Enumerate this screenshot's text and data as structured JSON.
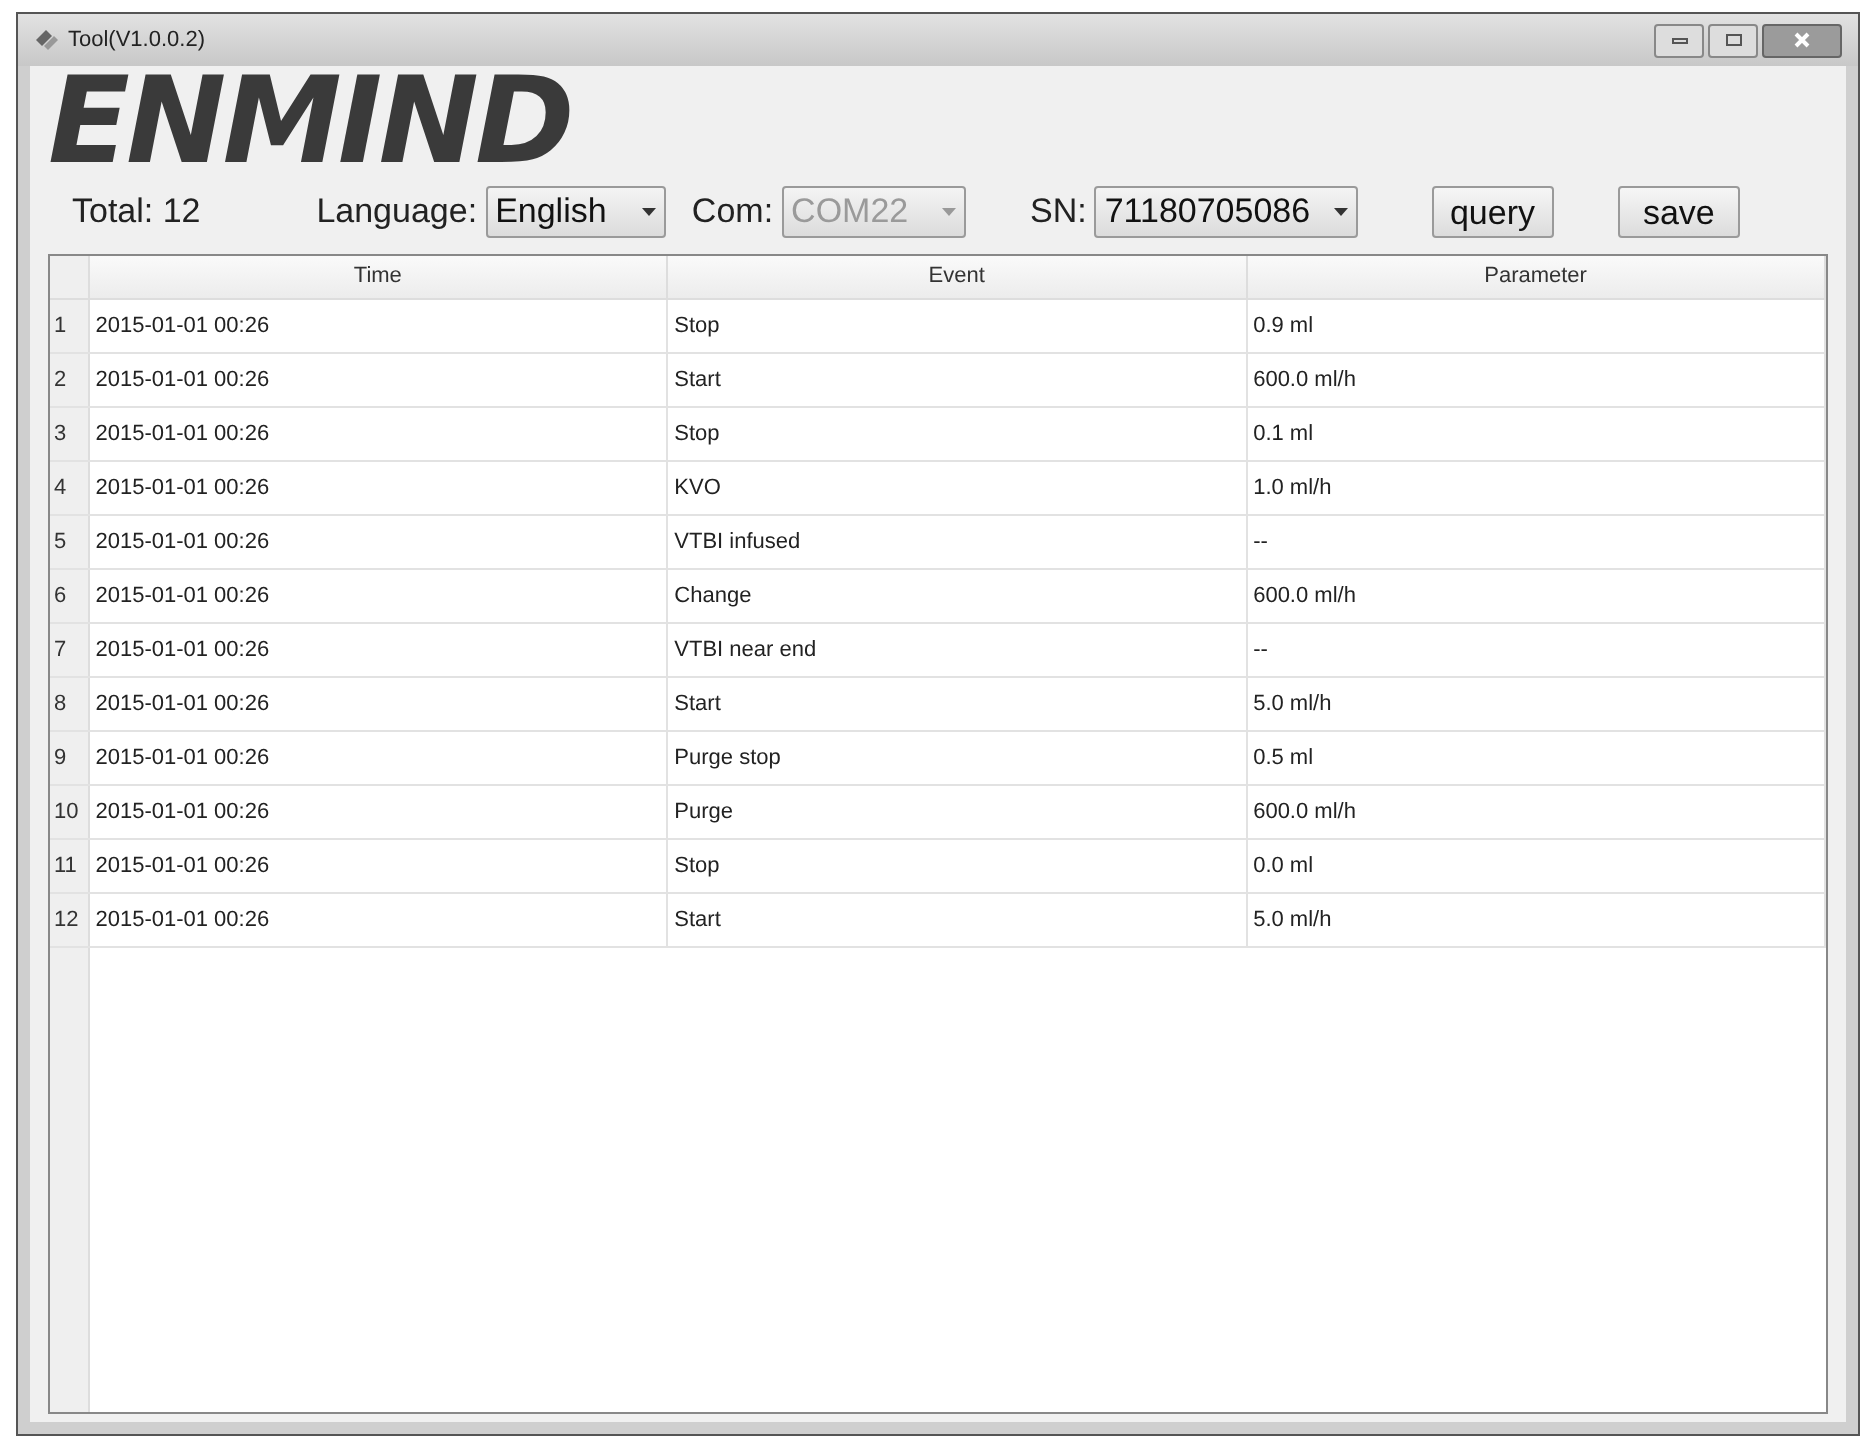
{
  "window": {
    "title": "Tool(V1.0.0.2)"
  },
  "logo": "ENMIND",
  "toolbar": {
    "total": "Total: 12",
    "language": {
      "label": "Language:",
      "value": "English",
      "disabled": false
    },
    "com": {
      "label": "Com:",
      "value": "COM22",
      "disabled": true
    },
    "sn": {
      "label": "SN:",
      "value": "71180705086",
      "disabled": false
    },
    "buttons": [
      "query",
      "save"
    ]
  },
  "table": {
    "columns": [
      "Time",
      "Event",
      "Parameter"
    ],
    "rows": [
      {
        "index": "1",
        "cells": [
          "2015-01-01 00:26",
          "Stop",
          "0.9 ml"
        ]
      },
      {
        "index": "2",
        "cells": [
          "2015-01-01 00:26",
          "Start",
          "600.0 ml/h"
        ]
      },
      {
        "index": "3",
        "cells": [
          "2015-01-01 00:26",
          "Stop",
          "0.1 ml"
        ]
      },
      {
        "index": "4",
        "cells": [
          "2015-01-01 00:26",
          "KVO",
          "1.0 ml/h"
        ]
      },
      {
        "index": "5",
        "cells": [
          "2015-01-01 00:26",
          "VTBI infused",
          "--"
        ]
      },
      {
        "index": "6",
        "cells": [
          "2015-01-01 00:26",
          "Change",
          "600.0 ml/h"
        ]
      },
      {
        "index": "7",
        "cells": [
          "2015-01-01 00:26",
          "VTBI near end",
          "--"
        ]
      },
      {
        "index": "8",
        "cells": [
          "2015-01-01 00:26",
          "Start",
          "5.0 ml/h"
        ]
      },
      {
        "index": "9",
        "cells": [
          "2015-01-01 00:26",
          "Purge stop",
          "0.5 ml"
        ]
      },
      {
        "index": "10",
        "cells": [
          "2015-01-01 00:26",
          "Purge",
          "600.0 ml/h"
        ]
      },
      {
        "index": "11",
        "cells": [
          "2015-01-01 00:26",
          "Stop",
          "0.0 ml"
        ]
      },
      {
        "index": "12",
        "cells": [
          "2015-01-01 00:26",
          "Start",
          "5.0 ml/h"
        ]
      }
    ]
  }
}
